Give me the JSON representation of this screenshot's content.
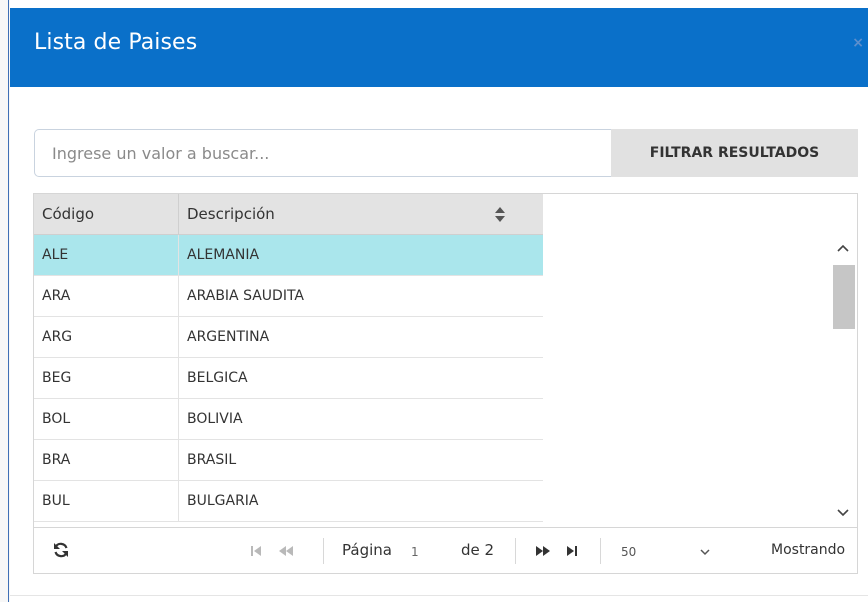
{
  "modal": {
    "title": "Lista de Paises",
    "close_glyph": "×"
  },
  "search": {
    "placeholder": "Ingrese un valor a buscar...",
    "value": "",
    "filter_button_label": "FILTRAR RESULTADOS"
  },
  "table": {
    "columns": [
      "Código",
      "Descripción"
    ],
    "rows": [
      {
        "code": "ALE",
        "description": "ALEMANIA"
      },
      {
        "code": "ARA",
        "description": "ARABIA SAUDITA"
      },
      {
        "code": "ARG",
        "description": "ARGENTINA"
      },
      {
        "code": "BEG",
        "description": "BELGICA"
      },
      {
        "code": "BOL",
        "description": "BOLIVIA"
      },
      {
        "code": "BRA",
        "description": "BRASIL"
      },
      {
        "code": "BUL",
        "description": "BULGARIA"
      }
    ],
    "selected_row": 0,
    "selected_color": "#aae6ec"
  },
  "pager": {
    "page_label": "Página",
    "current_page": "1",
    "of_label": "de 2",
    "page_size": "50",
    "showing_label": "Mostrando"
  },
  "colors": {
    "header_bg": "#0a70c9",
    "filter_button_bg": "#e1e1e1"
  },
  "icons": {
    "close": "close-icon",
    "sort": "sort-icon",
    "refresh": "refresh-icon",
    "first": "first-page-icon",
    "prev": "prev-page-icon",
    "next": "next-page-icon",
    "last": "last-page-icon",
    "dropdown": "chevron-down-icon",
    "scroll_up": "chevron-up-icon",
    "scroll_down": "chevron-down-icon"
  }
}
